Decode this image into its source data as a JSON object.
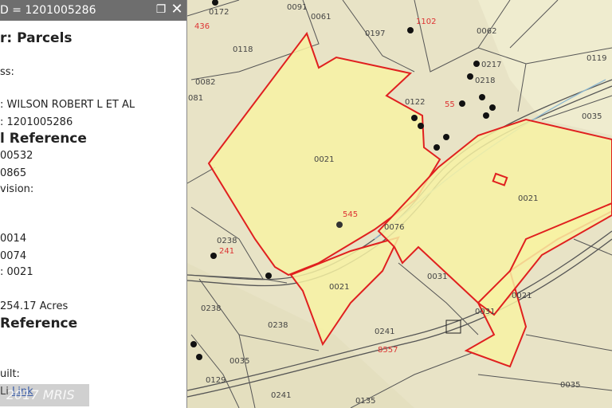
{
  "panel": {
    "title": "D = 1201005286",
    "layer_heading": "r: Parcels",
    "address_label": "ss:",
    "owner_line": ": WILSON ROBERT L ET AL",
    "id_line": ": 1201005286",
    "ref_heading": "l Reference",
    "ref_line1": "00532",
    "ref_line2": "0865",
    "subdivision_label": "vision:",
    "map_line1": "0014",
    "map_line2": "0074",
    "parcel_line": ": 0021",
    "acres_line": "254.17 Acres",
    "ref_heading2": "Reference",
    "built_label": "uilt:",
    "link_label": "Li",
    "link_text": "Link"
  },
  "watermark": "2017 MRIS",
  "map_labels": {
    "l0172": "0172",
    "l0091": "0091",
    "l0061": "0061",
    "l0197": "0197",
    "l0062": "0062",
    "l0118": "0118",
    "l0119": "0119",
    "l0082": "0082",
    "l0081": "081",
    "l0122": "0122",
    "l0035a": "0035",
    "l0021a": "0021",
    "l0021b": "0021",
    "l0021c": "0021",
    "l0021d": "0021",
    "l0238a": "0238",
    "l0238b": "0238",
    "l0238c": "0238",
    "l0076": "0076",
    "l0031a": "0031",
    "l0031b": "0031",
    "l0241a": "0241",
    "l0241b": "0241",
    "l0135": "0135",
    "l0129": "0129",
    "l0035b": "0035",
    "l0035c": "0035",
    "l0217": "0217",
    "l0218": "0218",
    "r1102": "1102",
    "r436": "436",
    "r545": "545",
    "r241": "241",
    "r8557": "8557",
    "r55": "55"
  },
  "colors": {
    "parcel_fill": "#f7f2a3",
    "parcel_stroke": "#e0201f",
    "panel_header": "#6e6e6e"
  }
}
